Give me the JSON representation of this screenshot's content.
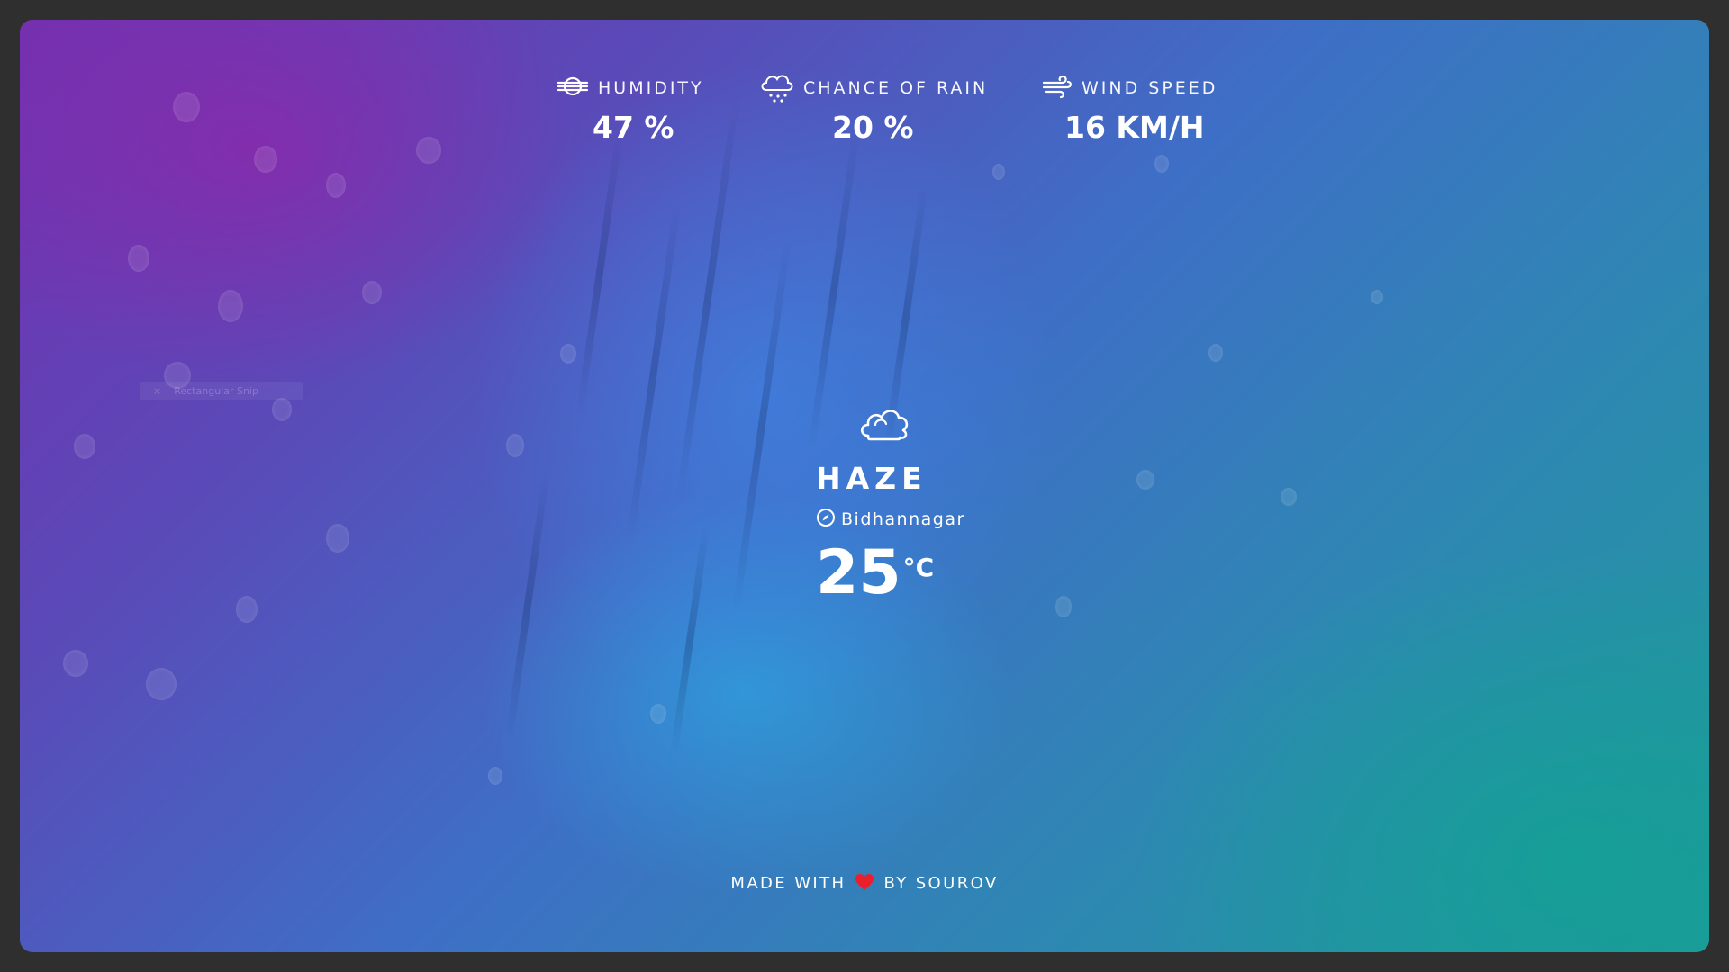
{
  "stats": {
    "humidity": {
      "label": "HUMIDITY",
      "value": "47 %",
      "icon": "humidity-icon"
    },
    "rain": {
      "label": "CHANCE OF RAIN",
      "value": "20 %",
      "icon": "rain-cloud-icon"
    },
    "wind": {
      "label": "WIND SPEED",
      "value": "16 KM/H",
      "icon": "wind-icon"
    }
  },
  "weather": {
    "condition": "HAZE",
    "icon": "cloud-icon",
    "location": "Bidhannagar",
    "location_icon": "compass-icon",
    "temperature": "25",
    "unit": "°C"
  },
  "footer": {
    "made_with": "MADE WITH",
    "by": "BY SOUROV",
    "heart_color": "#e8202c"
  },
  "overlay": {
    "close": "×",
    "label": "Rectangular Snip"
  },
  "colors": {
    "text": "#ffffff",
    "frame_bg": "#2f2f2f"
  }
}
